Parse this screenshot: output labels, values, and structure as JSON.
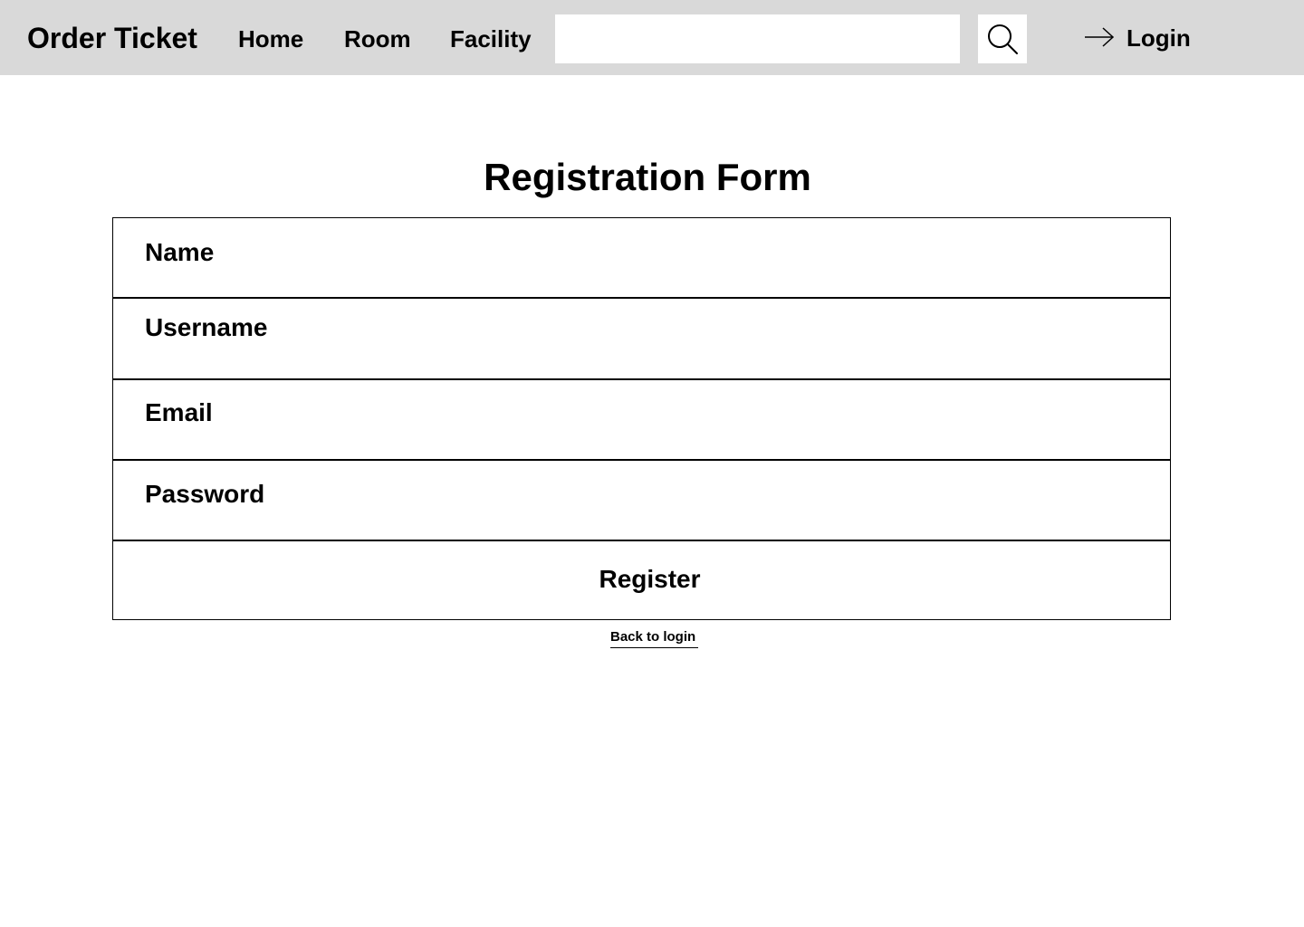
{
  "header": {
    "brand": "Order Ticket",
    "nav": {
      "home": "Home",
      "room": "Room",
      "facility": "Facility"
    },
    "search": {
      "value": "",
      "icon": "search-icon"
    },
    "login": {
      "label": "Login",
      "icon": "arrow-right-icon"
    },
    "background_color": "#d9d9d9"
  },
  "form": {
    "title": "Registration Form",
    "fields": {
      "name": "Name",
      "username": "Username",
      "email": "Email",
      "password": "Password"
    },
    "submit_label": "Register",
    "back_link": "Back to login"
  }
}
